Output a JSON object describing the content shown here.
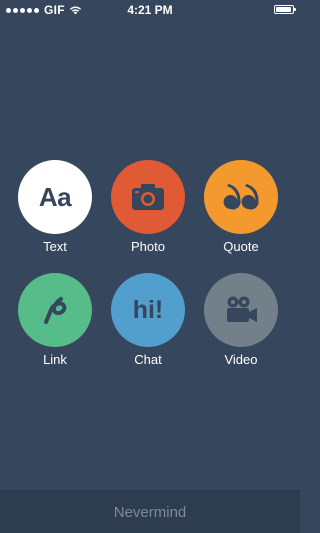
{
  "status_bar": {
    "carrier": "GIF",
    "time": "4:21 PM",
    "signal_bars_filled": 5
  },
  "post_options": [
    {
      "label": "Text",
      "icon": "text-aa-icon",
      "glyph": "Aa",
      "color": "#ffffff",
      "glyph_color": "#36465d"
    },
    {
      "label": "Photo",
      "icon": "camera-icon",
      "color": "#e05a36",
      "glyph_color": "#36465d"
    },
    {
      "label": "Quote",
      "icon": "quote-marks-icon",
      "glyph": "66",
      "color": "#f4992e",
      "glyph_color": "#36465d"
    },
    {
      "label": "Link",
      "icon": "link-icon",
      "color": "#56bc8a",
      "glyph_color": "#36465d"
    },
    {
      "label": "Chat",
      "icon": "chat-hi-icon",
      "glyph": "hi!",
      "color": "#529ecc",
      "glyph_color": "#36465d"
    },
    {
      "label": "Video",
      "icon": "video-camera-icon",
      "color": "#748089",
      "glyph_color": "#36465d"
    }
  ],
  "footer": {
    "cancel_label": "Nevermind"
  },
  "colors": {
    "background": "#36465d",
    "footer_background": "#2e3c50",
    "footer_text": "#7d8a9b"
  }
}
